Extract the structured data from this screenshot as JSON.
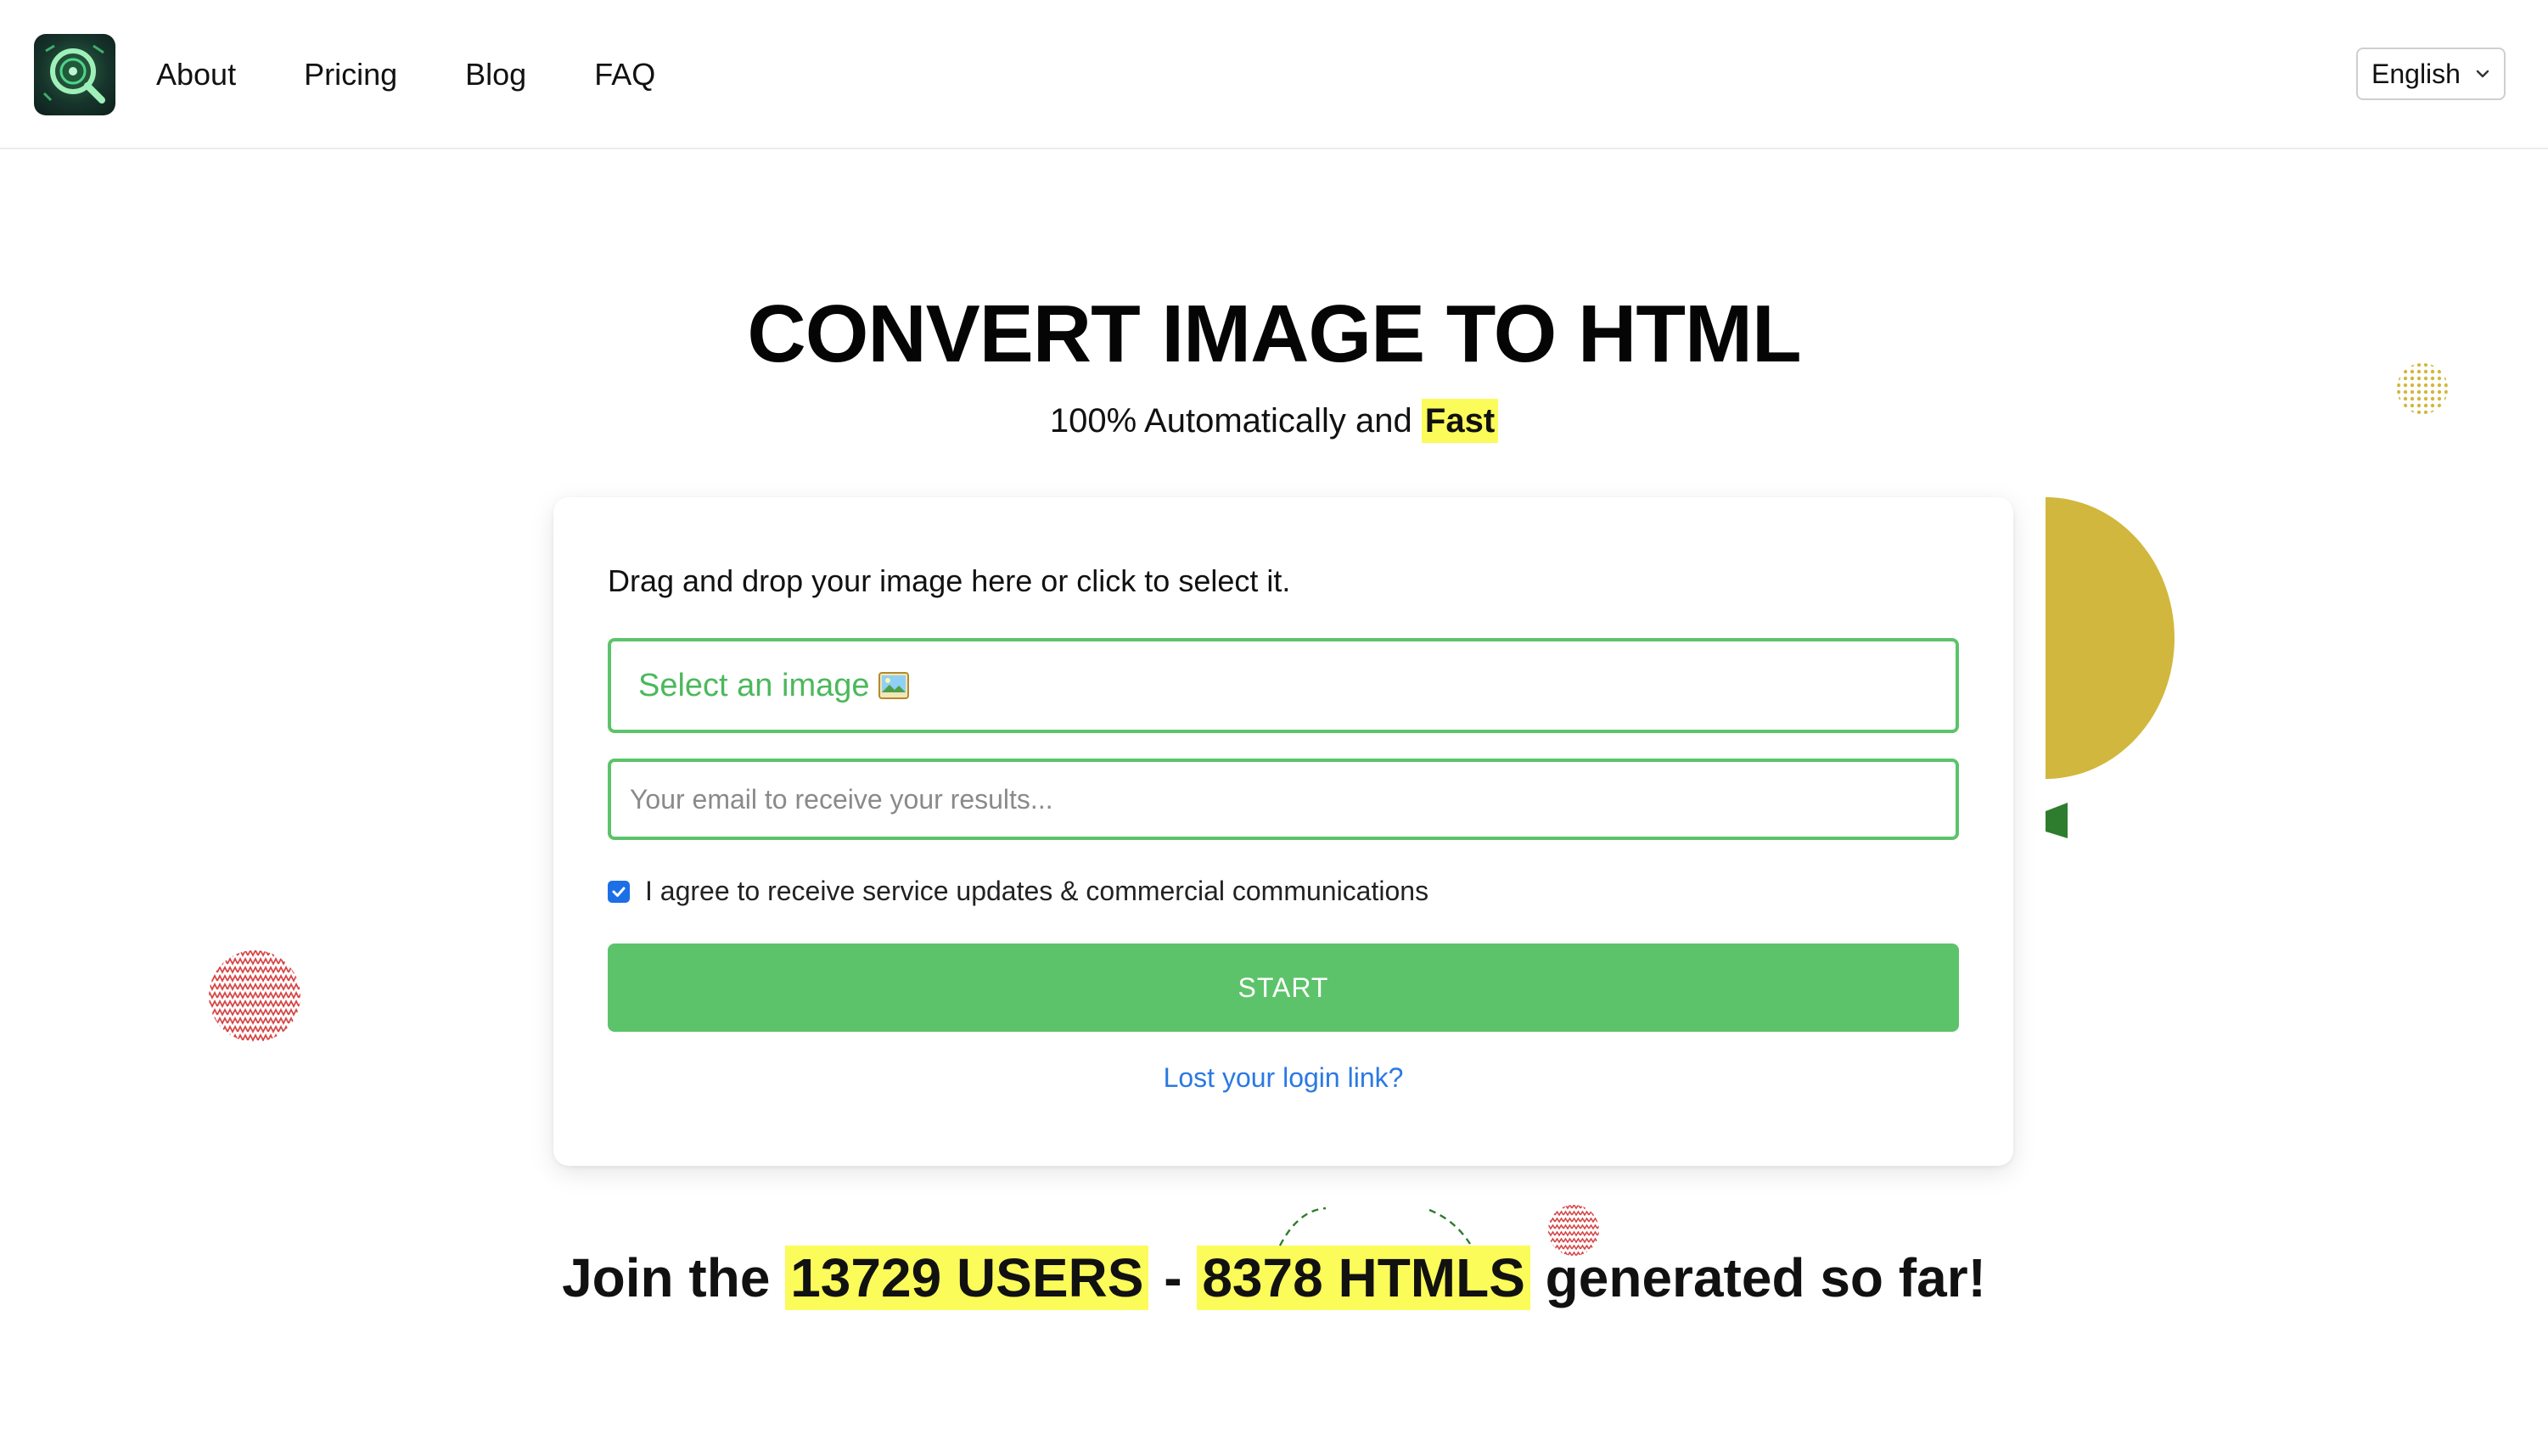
{
  "header": {
    "nav": [
      {
        "label": "About"
      },
      {
        "label": "Pricing"
      },
      {
        "label": "Blog"
      },
      {
        "label": "FAQ"
      }
    ],
    "language": {
      "selected": "English"
    }
  },
  "hero": {
    "title": "CONVERT IMAGE TO HTML",
    "subtitle_prefix": "100% Automatically and",
    "subtitle_highlight": "Fast"
  },
  "form": {
    "instruction": "Drag and drop your image here or click to select it.",
    "file_label": "Select an image",
    "email_placeholder": "Your email to receive your results...",
    "email_value": "",
    "agree_label": "I agree to receive service updates & commercial communications",
    "agree_checked": true,
    "start_label": "START",
    "lost_link": "Lost your login link?"
  },
  "stats": {
    "prefix": "Join the",
    "users": "13729 USERS",
    "separator": "-",
    "htmls": "8378 HTMLS",
    "suffix": "generated so far!"
  },
  "colors": {
    "accent_green": "#5cc36a",
    "link_blue": "#2a79e4",
    "highlight_yellow": "#fbfb5a",
    "deco_gold": "#d1b73d",
    "deco_red": "#d64545",
    "deco_green": "#2e7d2e"
  },
  "icons": {
    "logo": "magnifier-logo-icon",
    "language_dropdown": "chevron-down-icon",
    "file_picker": "picture-icon",
    "checkbox": "checkmark-icon"
  }
}
